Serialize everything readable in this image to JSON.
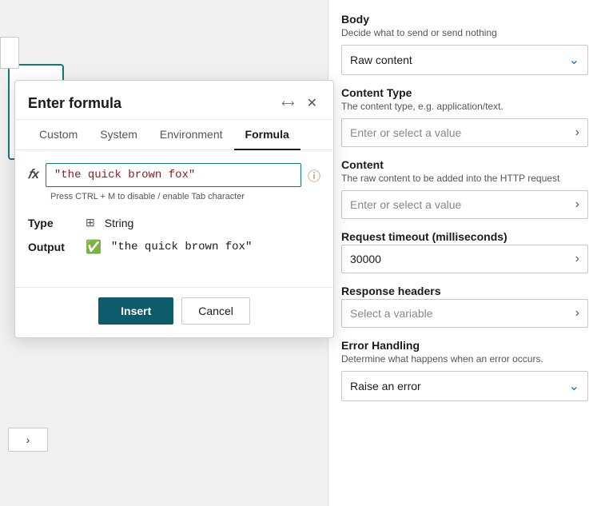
{
  "modal": {
    "title": "Enter formula",
    "tabs": [
      {
        "id": "custom",
        "label": "Custom"
      },
      {
        "id": "system",
        "label": "System"
      },
      {
        "id": "environment",
        "label": "Environment"
      },
      {
        "id": "formula",
        "label": "Formula"
      }
    ],
    "active_tab": "formula",
    "formula_input_value": "\"the quick brown fox\"",
    "hint_text": "Press CTRL + M to disable / enable Tab character",
    "type_label": "Type",
    "type_icon_name": "string-icon",
    "type_value": "String",
    "output_label": "Output",
    "output_value": "\"the quick brown fox\"",
    "insert_btn": "Insert",
    "cancel_btn": "Cancel"
  },
  "right_panel": {
    "body_label": "Body",
    "body_desc": "Decide what to send or send nothing",
    "body_dropdown_value": "Raw content",
    "content_type_label": "Content Type",
    "content_type_desc": "The content type, e.g. application/text.",
    "content_type_placeholder": "Enter or select a value",
    "content_label": "Content",
    "content_desc": "The raw content to be added into the HTTP request",
    "content_placeholder": "Enter or select a value",
    "timeout_label": "Request timeout (milliseconds)",
    "timeout_value": "30000",
    "response_headers_label": "Response headers",
    "response_headers_placeholder": "Select a variable",
    "error_handling_label": "Error Handling",
    "error_handling_desc": "Determine what happens when an error occurs.",
    "error_handling_value": "Raise an error"
  },
  "canvas": {
    "dots": "⋮",
    "arrow_btn_label": ">"
  }
}
